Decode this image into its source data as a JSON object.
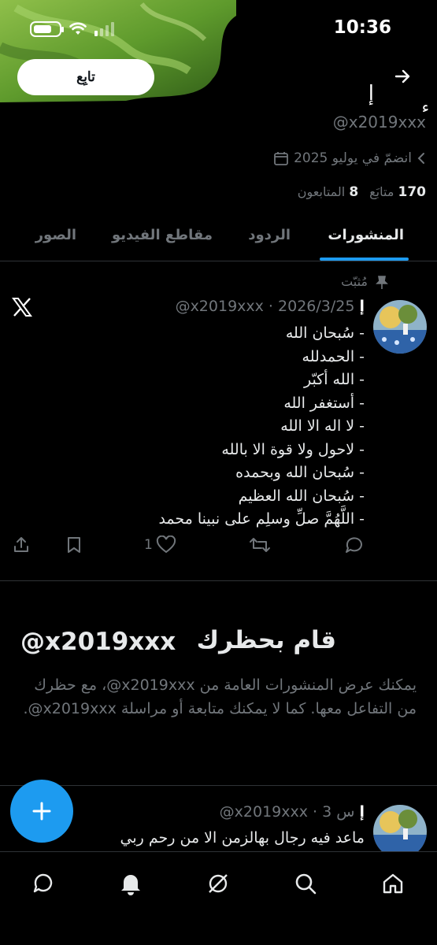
{
  "status_bar": {
    "time": "10:36"
  },
  "header": {
    "follow_label": "تابِع",
    "name_char": "إ",
    "name_tail": "ء",
    "handle": "@x2019xxx",
    "joined": "انضمّ في يوليو 2025",
    "following_count": "170",
    "following_label": "متابَع",
    "followers_count": "8",
    "followers_label": "المتابعون"
  },
  "tabs": [
    {
      "label": "المنشورات",
      "active": true
    },
    {
      "label": "الردود",
      "active": false
    },
    {
      "label": "مقاطع الفيديو",
      "active": false
    },
    {
      "label": "الصور",
      "active": false
    }
  ],
  "pinned_post": {
    "pinned_label": "مُثبّت",
    "author": "إ",
    "meta": "@x2019xxx · 2026/3/25",
    "lines": [
      "- سُبحان الله",
      "- الحمدلله",
      "- الله أكبّر",
      "- أستغفر الله",
      "- لا اله الا الله",
      "- لاحول ولا قوة الا بالله",
      "- سُبحان الله وبحمده",
      "- سُبحان الله العظيم",
      "- اللَّهُمَّ صلِّ وسلِم على نبينا محمد"
    ],
    "like_count": "1"
  },
  "blocked": {
    "title": "قام بحظرك",
    "handle": "@x2019xxx",
    "text": "يمكنك عرض المنشورات العامة من ‎@x2019xxx، مع حظرك من التفاعل معها. كما لا يمكنك متابعة أو مراسلة ‎@x2019xxx."
  },
  "second_post": {
    "author": "إ",
    "meta": "@x2019xxx · 3 س",
    "text": "ماعد فيه رجال بهالزمن الا من رحم ربي"
  },
  "colors": {
    "accent": "#1d9bf0",
    "muted": "#71767b",
    "text": "#e7e9ea",
    "background": "#000000"
  }
}
